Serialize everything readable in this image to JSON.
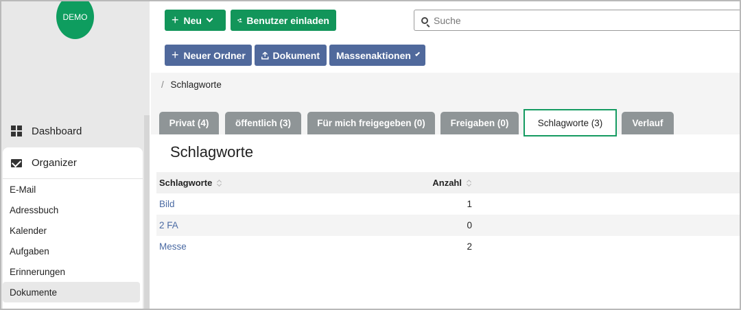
{
  "logo": {
    "text": "DEMO"
  },
  "sidebar": {
    "dashboard_label": "Dashboard",
    "organizer_label": "Organizer",
    "items": [
      {
        "label": "E-Mail"
      },
      {
        "label": "Adressbuch"
      },
      {
        "label": "Kalender"
      },
      {
        "label": "Aufgaben"
      },
      {
        "label": "Erinnerungen"
      },
      {
        "label": "Dokumente"
      }
    ],
    "active_item": "Dokumente"
  },
  "toolbar": {
    "new_label": "Neu",
    "invite_label": "Benutzer einladen",
    "new_folder_label": "Neuer Ordner",
    "document_label": "Dokument",
    "bulk_label": "Massenaktionen"
  },
  "search": {
    "placeholder": "Suche"
  },
  "breadcrumb": {
    "separator": "/",
    "current": "Schlagworte"
  },
  "tabs": [
    {
      "label": "Privat (4)"
    },
    {
      "label": "öffentlich (3)"
    },
    {
      "label": "Für mich freigegeben (0)"
    },
    {
      "label": "Freigaben (0)"
    },
    {
      "label": "Schlagworte (3)"
    },
    {
      "label": "Verlauf"
    }
  ],
  "active_tab": "Schlagworte (3)",
  "content": {
    "title": "Schlagworte"
  },
  "table": {
    "columns": [
      "Schlagworte",
      "Anzahl"
    ],
    "rows": [
      {
        "tag": "Bild",
        "count": "1"
      },
      {
        "tag": "2 FA",
        "count": "0"
      },
      {
        "tag": "Messe",
        "count": "2"
      }
    ]
  },
  "colors": {
    "primary_green": "#12955a",
    "button_blue": "#50699c",
    "tab_gray": "#8f9597",
    "link_blue": "#4a6aa3"
  }
}
